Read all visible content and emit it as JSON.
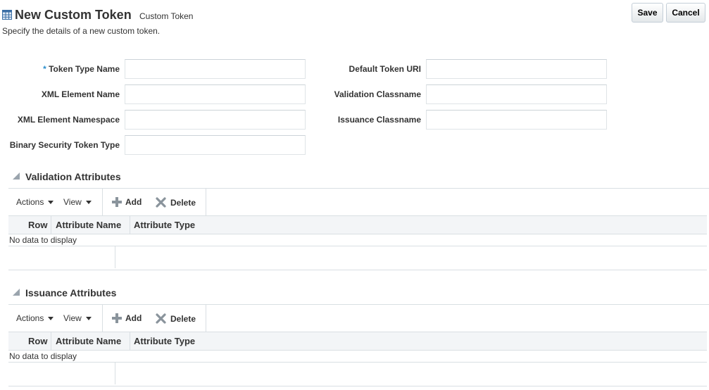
{
  "header": {
    "title": "New Custom Token",
    "subtitle": "Custom Token",
    "description": "Specify the details of a new custom token.",
    "icon": "table-grid-icon",
    "save_label": "Save",
    "cancel_label": "Cancel"
  },
  "form": {
    "left": [
      {
        "label": "Token Type Name",
        "required": "*",
        "value": "",
        "placeholder": ""
      },
      {
        "label": "XML Element Name",
        "value": "",
        "placeholder": ""
      },
      {
        "label": "XML Element Namespace",
        "value": "",
        "placeholder": ""
      },
      {
        "label": "Binary Security Token Type",
        "value": "",
        "placeholder": ""
      }
    ],
    "right": [
      {
        "label": "Default Token URI",
        "value": "",
        "placeholder": ""
      },
      {
        "label": "Validation Classname",
        "value": "",
        "placeholder": ""
      },
      {
        "label": "Issuance Classname",
        "value": "",
        "placeholder": ""
      }
    ]
  },
  "sections": [
    {
      "title": "Validation Attributes",
      "toolbar": {
        "actions": "Actions",
        "view": "View",
        "add": "Add",
        "delete": "Delete"
      },
      "columns": [
        "Row",
        "Attribute Name",
        "Attribute Type"
      ],
      "empty_text": "No data to display"
    },
    {
      "title": "Issuance Attributes",
      "toolbar": {
        "actions": "Actions",
        "view": "View",
        "add": "Add",
        "delete": "Delete"
      },
      "columns": [
        "Row",
        "Attribute Name",
        "Attribute Type"
      ],
      "empty_text": "No data to display"
    }
  ],
  "colors": {
    "accent": "#2a8ecc",
    "header_bg": "#f3f5f7",
    "border": "#d9dfe3"
  }
}
